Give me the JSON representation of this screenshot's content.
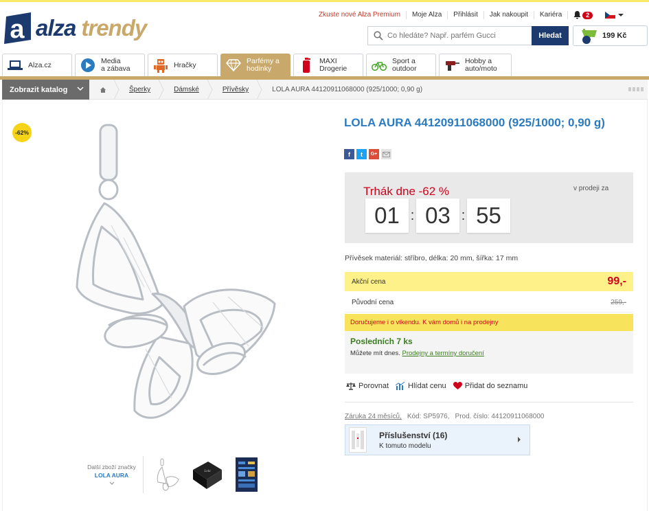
{
  "logo": {
    "alza": "alza",
    "trendy": "trendy"
  },
  "toplinks": {
    "premium": "Zkuste nové Alza Premium",
    "account": "Moje Alza",
    "login": "Přihlásit",
    "howto": "Jak nakoupit",
    "career": "Kariéra",
    "notifications": "2"
  },
  "search": {
    "placeholder": "Co hledáte? Např. parfém Gucci",
    "button": "Hledat"
  },
  "cart": {
    "count": "1",
    "total": "199 Kč"
  },
  "tabs": [
    {
      "line1": "Alza.cz",
      "line2": "",
      "icon": "laptop-icon"
    },
    {
      "line1": "Media",
      "line2": "a zábava",
      "icon": "play-icon"
    },
    {
      "line1": "Hračky",
      "line2": "",
      "icon": "robot-icon"
    },
    {
      "line1": "Parfémy a",
      "line2": "hodinky",
      "icon": "diamond-icon"
    },
    {
      "line1": "MAXI",
      "line2": "Drogerie",
      "icon": "bottle-icon"
    },
    {
      "line1": "Sport a",
      "line2": "outdoor",
      "icon": "bike-icon"
    },
    {
      "line1": "Hobby a",
      "line2": "auto/moto",
      "icon": "drill-icon"
    }
  ],
  "catalog": {
    "label": "Zobrazit katalog"
  },
  "breadcrumb": [
    "Šperky",
    "Dámské",
    "Přívěsky",
    "LOLA AURA 44120911068000 (925/1000; 0,90 g)"
  ],
  "product": {
    "discount": "-62%",
    "title": "LOLA AURA 44120911068000 (925/1000; 0,90 g)",
    "deal_title": "Trhák dne -62 %",
    "deal_sale": "v prodeji za",
    "timer": [
      "01",
      "03",
      "55"
    ],
    "material": "Přívěsek materiál: stříbro, délka: 20 mm, šířka: 17 mm",
    "action_label": "Akční cena",
    "action_price": "99,-",
    "orig_label": "Původní cena",
    "orig_price": "259,-",
    "delivery": "Doručujeme i o víkendu. K vám domů i na prodejny",
    "stock": "Posledních 7 ks",
    "stock_sub": "Můžete mít dnes.",
    "stock_link": "Prodejny a termíny doručení",
    "compare": "Porovnat",
    "watch": "Hlídat cenu",
    "wishlist": "Přidat do seznamu",
    "warranty": "Záruka 24 měsíců,",
    "code": "Kód: SP5976,",
    "prod_no": "Prod. číslo: 44120911068000",
    "accessory_title": "Příslušenství (16)",
    "accessory_sub": "K tomuto modelu",
    "more_from": "Další zboží značky",
    "brand": "LOLA AURA"
  },
  "colors": {
    "brand_navy": "#1c3a6e",
    "gold": "#c8a96b",
    "link_blue": "#2b7bc0",
    "red": "#d0021b"
  }
}
